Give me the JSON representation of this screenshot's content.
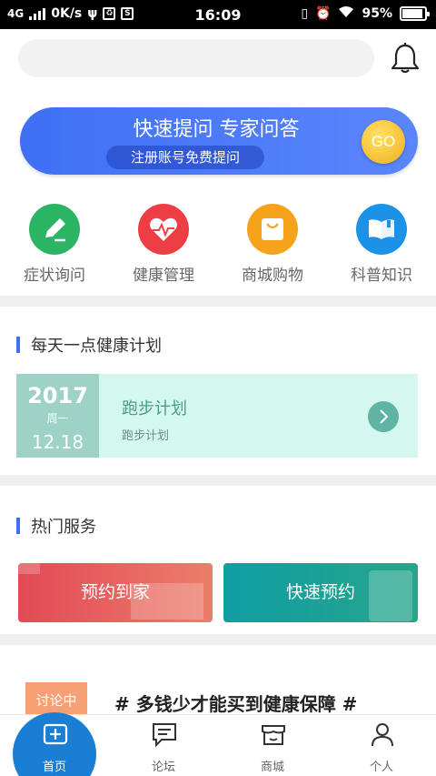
{
  "status": {
    "network": "4G",
    "speed": "0K/s",
    "time": "16:09",
    "battery": "95%"
  },
  "search": {
    "placeholder": ""
  },
  "banner": {
    "title": "快速提问 专家问答",
    "subtitle": "注册账号免费提问",
    "go": "GO"
  },
  "quick_nav": [
    {
      "label": "症状询问",
      "icon": "pen-icon",
      "color": "#2cb465"
    },
    {
      "label": "健康管理",
      "icon": "heart-pulse-icon",
      "color": "#ee3e45"
    },
    {
      "label": "商城购物",
      "icon": "shopping-bag-icon",
      "color": "#f7a21b"
    },
    {
      "label": "科普知识",
      "icon": "book-icon",
      "color": "#1b92e6"
    }
  ],
  "health_plan": {
    "section_title": "每天一点健康计划",
    "year": "2017",
    "weekday": "周一",
    "date": "12.18",
    "title": "跑步计划",
    "subtitle": "跑步计划"
  },
  "hot_services": {
    "section_title": "热门服务",
    "items": [
      {
        "label": "预约到家"
      },
      {
        "label": "快速预约"
      }
    ]
  },
  "discussion": {
    "tag": "讨论中",
    "title": "# 多钱少才能买到健康保障 #"
  },
  "tabbar": [
    {
      "label": "首页",
      "icon": "plus-box-icon",
      "active": true
    },
    {
      "label": "论坛",
      "icon": "chat-icon",
      "active": false
    },
    {
      "label": "商城",
      "icon": "store-icon",
      "active": false
    },
    {
      "label": "个人",
      "icon": "person-icon",
      "active": false
    }
  ]
}
